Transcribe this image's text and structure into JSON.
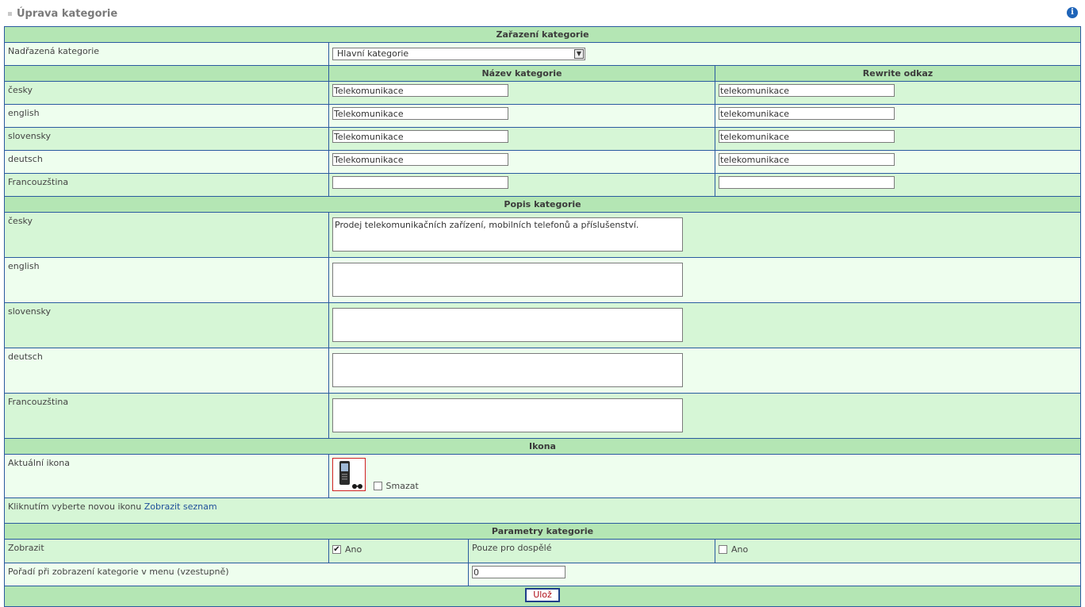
{
  "page": {
    "title": "Úprava kategorie",
    "info_icon": "i"
  },
  "section_zarazeni": {
    "header": "Zařazení kategorie",
    "parent_label": "Nadřazená kategorie",
    "parent_value": "Hlavní kategorie",
    "select_arrow": "▼"
  },
  "names": {
    "col_name": "Název kategorie",
    "col_rewrite": "Rewrite odkaz",
    "rows": [
      {
        "lang": "česky",
        "name": "Telekomunikace",
        "rewrite": "telekomunikace"
      },
      {
        "lang": "english",
        "name": "Telekomunikace",
        "rewrite": "telekomunikace"
      },
      {
        "lang": "slovensky",
        "name": "Telekomunikace",
        "rewrite": "telekomunikace"
      },
      {
        "lang": "deutsch",
        "name": "Telekomunikace",
        "rewrite": "telekomunikace"
      },
      {
        "lang": "Francouzština",
        "name": "",
        "rewrite": ""
      }
    ]
  },
  "description": {
    "header": "Popis kategorie",
    "rows": [
      {
        "lang": "česky",
        "value": "Prodej telekomunikačních zařízení, mobilních telefonů a příslušenství."
      },
      {
        "lang": "english",
        "value": ""
      },
      {
        "lang": "slovensky",
        "value": ""
      },
      {
        "lang": "deutsch",
        "value": ""
      },
      {
        "lang": "Francouzština",
        "value": ""
      }
    ]
  },
  "icon": {
    "header": "Ikona",
    "current_label": "Aktuální ikona",
    "delete_label": "Smazat",
    "delete_checked": false,
    "pick_text": "Kliknutím vyberte novou ikonu",
    "pick_link": "Zobrazit seznam"
  },
  "params": {
    "header": "Parametry kategorie",
    "show_label": "Zobrazit",
    "show_value": "Ano",
    "show_checked": true,
    "adult_label": "Pouze pro dospělé",
    "adult_value": "Ano",
    "adult_checked": false,
    "order_label": "Pořadí při zobrazení kategorie v menu (vzestupně)",
    "order_value": "0"
  },
  "actions": {
    "save_label": "Ulož"
  },
  "colors": {
    "header_bg": "#b4e6b4",
    "row_a": "#d6f6d6",
    "row_b": "#eefeee",
    "border": "#2a5aa0",
    "link": "#1f4f9a"
  }
}
